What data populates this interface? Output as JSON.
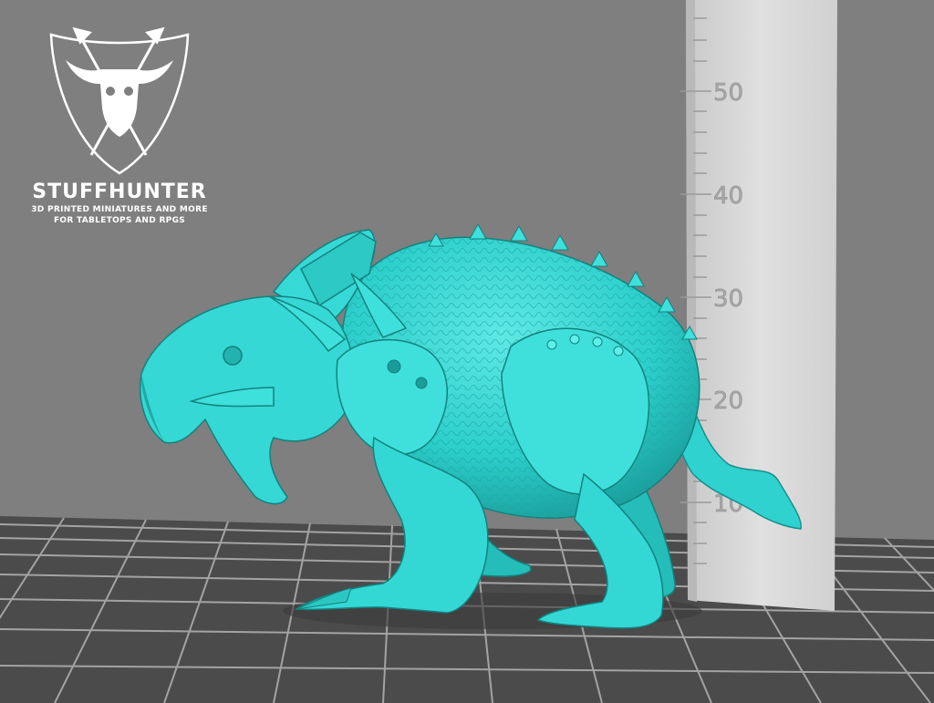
{
  "logo": {
    "brand": "STUFFHUNTER",
    "tagline_1": "3D PRINTED MINIATURES AND MORE",
    "tagline_2": "FOR TABLETOPS AND RPGS"
  },
  "ruler": {
    "ticks": [
      "50",
      "40",
      "30",
      "20",
      "10"
    ]
  },
  "colors": {
    "background": "#7f7f7f",
    "model": "#2ed5d2",
    "floor": "#4a4a4a",
    "grid": "#9a9a9a",
    "ruler": "#d8d8d8"
  }
}
